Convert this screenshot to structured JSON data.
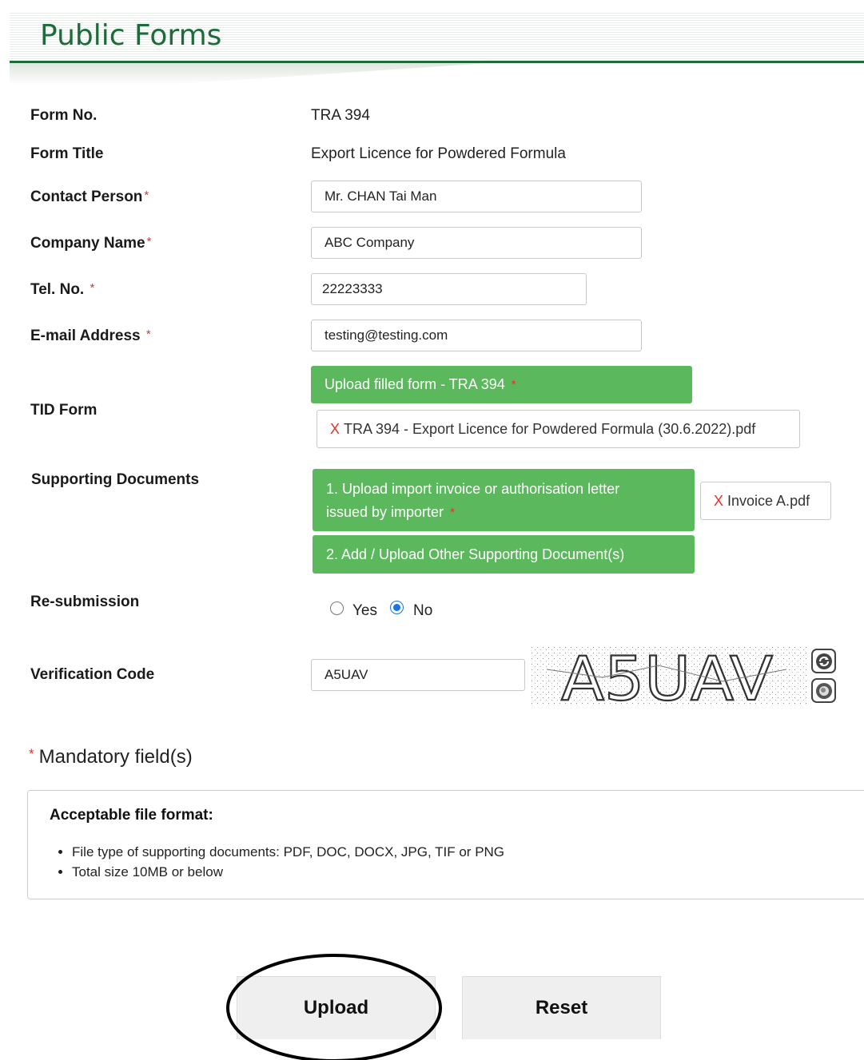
{
  "banner": {
    "title": "Public Forms"
  },
  "form": {
    "form_no": {
      "label": "Form No.",
      "value": "TRA 394"
    },
    "form_title": {
      "label": "Form Title",
      "value": "Export Licence for Powdered Formula"
    },
    "contact_person": {
      "label": "Contact Person",
      "value": "Mr. CHAN Tai Man"
    },
    "company_name": {
      "label": "Company Name",
      "value": "ABC Company"
    },
    "tel_no": {
      "label": "Tel. No.",
      "value": "22223333"
    },
    "email": {
      "label": "E-mail Address",
      "value": "testing@testing.com"
    },
    "required_mark": "*"
  },
  "tid_form": {
    "label": "TID Form",
    "upload_label": "Upload filled form - TRA 394",
    "file_name": "TRA 394 - Export Licence for Powdered Formula (30.6.2022).pdf",
    "remove_mark": "X"
  },
  "supporting_docs": {
    "label": "Supporting Documents",
    "upload_invoice_line1": "1. Upload import invoice or authorisation letter",
    "upload_invoice_line2": "issued by importer",
    "upload_other": "2. Add / Upload Other Supporting Document(s)",
    "file_name": "Invoice A.pdf",
    "remove_mark": "X"
  },
  "resubmission": {
    "label": "Re-submission",
    "options": [
      "Yes",
      "No"
    ],
    "selected": "No"
  },
  "verification": {
    "label": "Verification Code",
    "value": "A5UAV",
    "captcha_text": "A5UAV",
    "refresh_icon": "refresh-icon",
    "audio_icon": "speaker-icon"
  },
  "mandatory_note": "Mandatory field(s)",
  "file_format": {
    "title": "Acceptable file format:",
    "items": [
      "File type of supporting documents: PDF, DOC, DOCX, JPG, TIF or PNG",
      "Total size 10MB or below"
    ]
  },
  "actions": {
    "upload_label": "Upload",
    "reset_label": "Reset"
  },
  "colors": {
    "brand_green": "#1d6a3a",
    "button_green": "#5cb85c",
    "required_red": "#e0342e",
    "radio_blue": "#1a73e8"
  }
}
